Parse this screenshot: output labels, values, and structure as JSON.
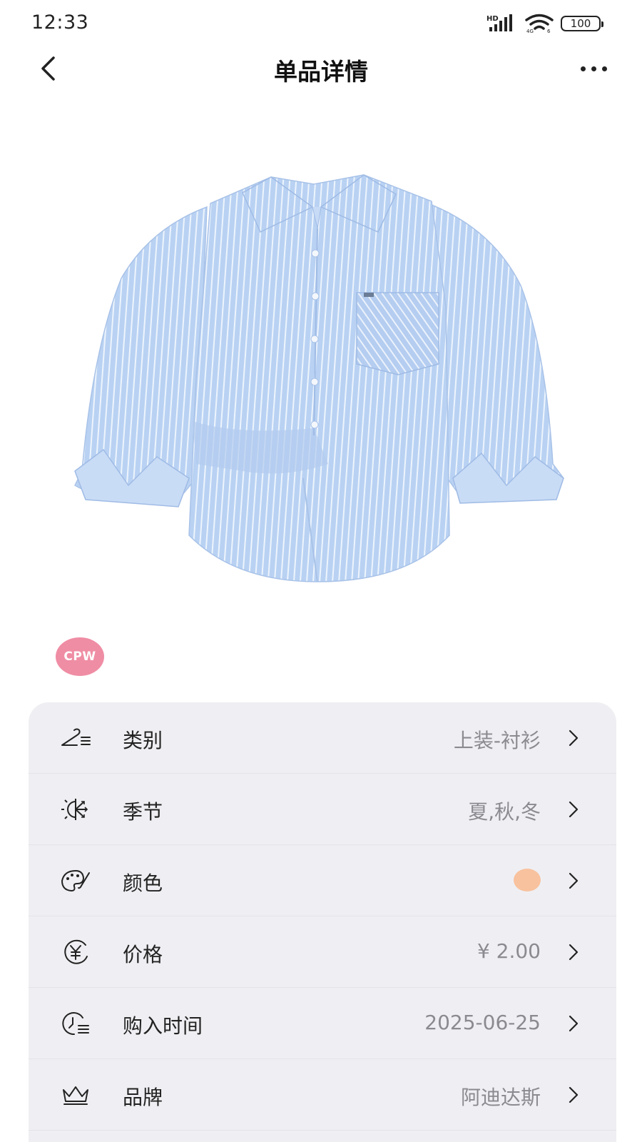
{
  "status_bar": {
    "time": "12:33",
    "hd_label": "HD",
    "battery": "100"
  },
  "nav": {
    "title": "单品详情"
  },
  "product": {
    "brand_badge": "CPW",
    "shirt_color": "#b9d2f3",
    "stripe_color": "#ffffff"
  },
  "details": {
    "category": {
      "label": "类别",
      "value": "上装-衬衫",
      "icon": "hanger-icon"
    },
    "season": {
      "label": "季节",
      "value": "夏,秋,冬",
      "icon": "sun-snow-icon"
    },
    "color": {
      "label": "颜色",
      "swatch": "#f8c29e",
      "icon": "palette-icon"
    },
    "price": {
      "label": "价格",
      "value": "¥ 2.00",
      "icon": "yen-icon"
    },
    "purchase_date": {
      "label": "购入时间",
      "value": "2025-06-25",
      "icon": "clock-list-icon"
    },
    "brand": {
      "label": "品牌",
      "value": "阿迪达斯",
      "icon": "crown-icon"
    }
  }
}
